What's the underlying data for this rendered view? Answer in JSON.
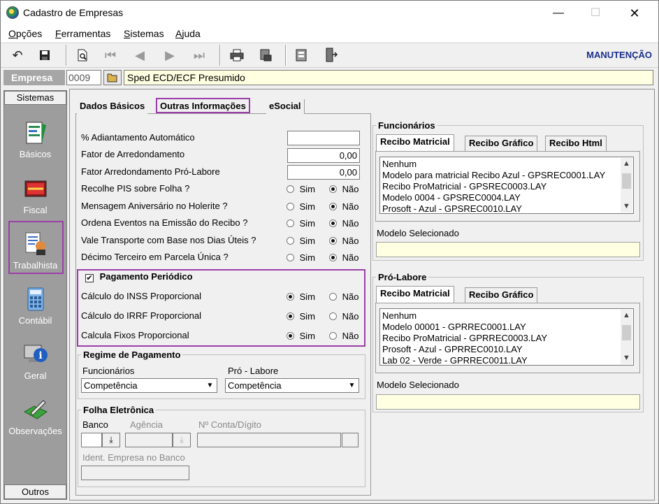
{
  "window": {
    "title": "Cadastro de Empresas",
    "controls": {
      "minimize": "—",
      "maximize": "☐",
      "close": "✕"
    }
  },
  "menu": [
    {
      "label": "Opções"
    },
    {
      "label": "Ferramentas"
    },
    {
      "label": "Sistemas"
    },
    {
      "label": "Ajuda"
    }
  ],
  "toolbar": {
    "mode_label": "MANUTENÇÃO",
    "buttons": [
      "undo-icon",
      "save-icon",
      "preview-icon",
      "first-icon",
      "prev-icon",
      "next-icon",
      "last-icon",
      "print-icon",
      "print-setup-icon",
      "tools-icon",
      "exit-icon"
    ]
  },
  "empresa": {
    "label": "Empresa",
    "code": "0009",
    "name": "Sped ECD/ECF Presumido"
  },
  "sidebar": {
    "header": "Sistemas",
    "footer": "Outros",
    "items": [
      {
        "label": "Básicos",
        "icon": "document-chart-icon"
      },
      {
        "label": "Fiscal",
        "icon": "fiscal-book-icon"
      },
      {
        "label": "Trabalhista",
        "icon": "worker-icon"
      },
      {
        "label": "Contábil",
        "icon": "calculator-icon"
      },
      {
        "label": "Geral",
        "icon": "info-computer-icon"
      },
      {
        "label": "Observações",
        "icon": "pen-notes-icon"
      }
    ],
    "selected": "Trabalhista"
  },
  "tabs": [
    {
      "label": "Dados Básicos"
    },
    {
      "label": "Outras Informações"
    },
    {
      "label": "eSocial"
    }
  ],
  "fields": {
    "adiantamento_label": "% Adiantamento Automático",
    "adiantamento_value": "",
    "fator_label": "Fator de Arredondamento",
    "fator_value": "0,00",
    "fator_pro_label": "Fator Arredondamento Pró-Labore",
    "fator_pro_value": "0,00"
  },
  "yesno": {
    "sim": "Sim",
    "nao": "Não",
    "rows": [
      {
        "label": "Recolhe PIS sobre Folha ?",
        "selected": "nao"
      },
      {
        "label": "Mensagem Aniversário no Holerite ?",
        "selected": "nao"
      },
      {
        "label": "Ordena Eventos na Emissão do Recibo ?",
        "selected": "nao"
      },
      {
        "label": "Vale Transporte com Base nos Dias Úteis ?",
        "selected": "nao"
      },
      {
        "label": "Décimo Terceiro em Parcela Única ?",
        "selected": "nao"
      }
    ]
  },
  "pagamento_periodico": {
    "title": "Pagamento Periódico",
    "checked": true,
    "check_mark": "✔",
    "rows": [
      {
        "label": "Cálculo do INSS Proporcional",
        "selected": "sim"
      },
      {
        "label": "Cálculo do IRRF Proporcional",
        "selected": "sim"
      },
      {
        "label": "Calcula Fixos Proporcional",
        "selected": "sim"
      }
    ]
  },
  "regime": {
    "title": "Regime de Pagamento",
    "funcionarios_label": "Funcionários",
    "funcionarios_value": "Competência",
    "prolabore_label": "Pró - Labore",
    "prolabore_value": "Competência"
  },
  "folha": {
    "title": "Folha Eletrônica",
    "banco_label": "Banco",
    "agencia_label": "Agência",
    "conta_label": "Nº Conta/Dígito",
    "ident_label": "Ident. Empresa no Banco"
  },
  "funcionarios": {
    "title": "Funcionários",
    "tabs": [
      "Recibo Matricial",
      "Recibo Gráfico",
      "Recibo Html"
    ],
    "list": [
      "Nenhum",
      "Modelo para matricial Recibo Azul - GPSREC0001.LAY",
      "Recibo ProMatricial - GPSREC0003.LAY",
      "Modelo 0004 - GPSREC0004.LAY",
      "Prosoft - Azul - GPSREC0010.LAY"
    ],
    "modelo_label": "Modelo Selecionado",
    "modelo_value": ""
  },
  "prolabore": {
    "title": "Pró-Labore",
    "tabs": [
      "Recibo Matricial",
      "Recibo Gráfico"
    ],
    "list": [
      "Nenhum",
      "Modelo 00001 - GPRREC0001.LAY",
      "Recibo ProMatricial - GPRREC0003.LAY",
      "Prosoft - Azul - GPRREC0010.LAY",
      "Lab 02 - Verde - GPRREC0011.LAY"
    ],
    "modelo_label": "Modelo Selecionado",
    "modelo_value": ""
  }
}
